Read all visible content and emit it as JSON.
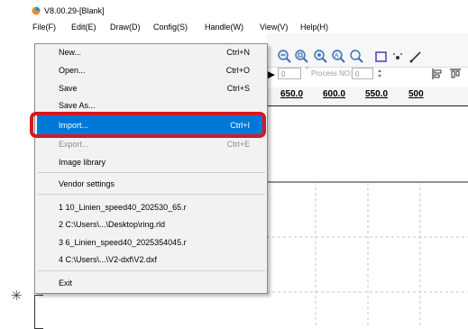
{
  "window": {
    "title": "V8.00.29-[Blank]"
  },
  "menubar": [
    "File(F)",
    "Edit(E)",
    "Draw(D)",
    "Config(S)",
    "Handle(W)",
    "View(V)",
    "Help(H)"
  ],
  "file_menu": {
    "items": [
      {
        "label": "New...",
        "shortcut": "Ctrl+N"
      },
      {
        "label": "Open...",
        "shortcut": "Ctrl+O"
      },
      {
        "label": "Save",
        "shortcut": "Ctrl+S"
      },
      {
        "label": "Save As..."
      },
      {
        "label": "Import...",
        "shortcut": "Ctrl+I",
        "highlighted": true
      },
      {
        "label": "Export...",
        "shortcut": "Ctrl+E",
        "disabled": true
      },
      {
        "label": "Image library"
      },
      {
        "label": "Vendor settings"
      },
      {
        "label": "1 10_Linien_speed40_202530_65.r"
      },
      {
        "label": "2 C:\\Users\\...\\Desktop\\ring.rld"
      },
      {
        "label": "3 6_Linien_speed40_2025354045.r"
      },
      {
        "label": "4 C:\\Users\\...\\V2-dxf\\V2.dxf"
      },
      {
        "label": "Exit"
      }
    ]
  },
  "toolbar": {
    "icons": [
      "zoom-out-icon",
      "zoom-in-icon",
      "zoom-fit-icon",
      "zoom-area-icon",
      "zoom-page-icon",
      "select-rect-icon",
      "node-icon",
      "pen-icon"
    ],
    "field_value": "0",
    "process_label": "Process NO:",
    "process_value": "0"
  },
  "ruler": {
    "labels": [
      "650.0",
      "600.0",
      "550.0",
      "500"
    ]
  },
  "colors": {
    "highlight": "#0078d7",
    "callout": "#d31a22"
  }
}
